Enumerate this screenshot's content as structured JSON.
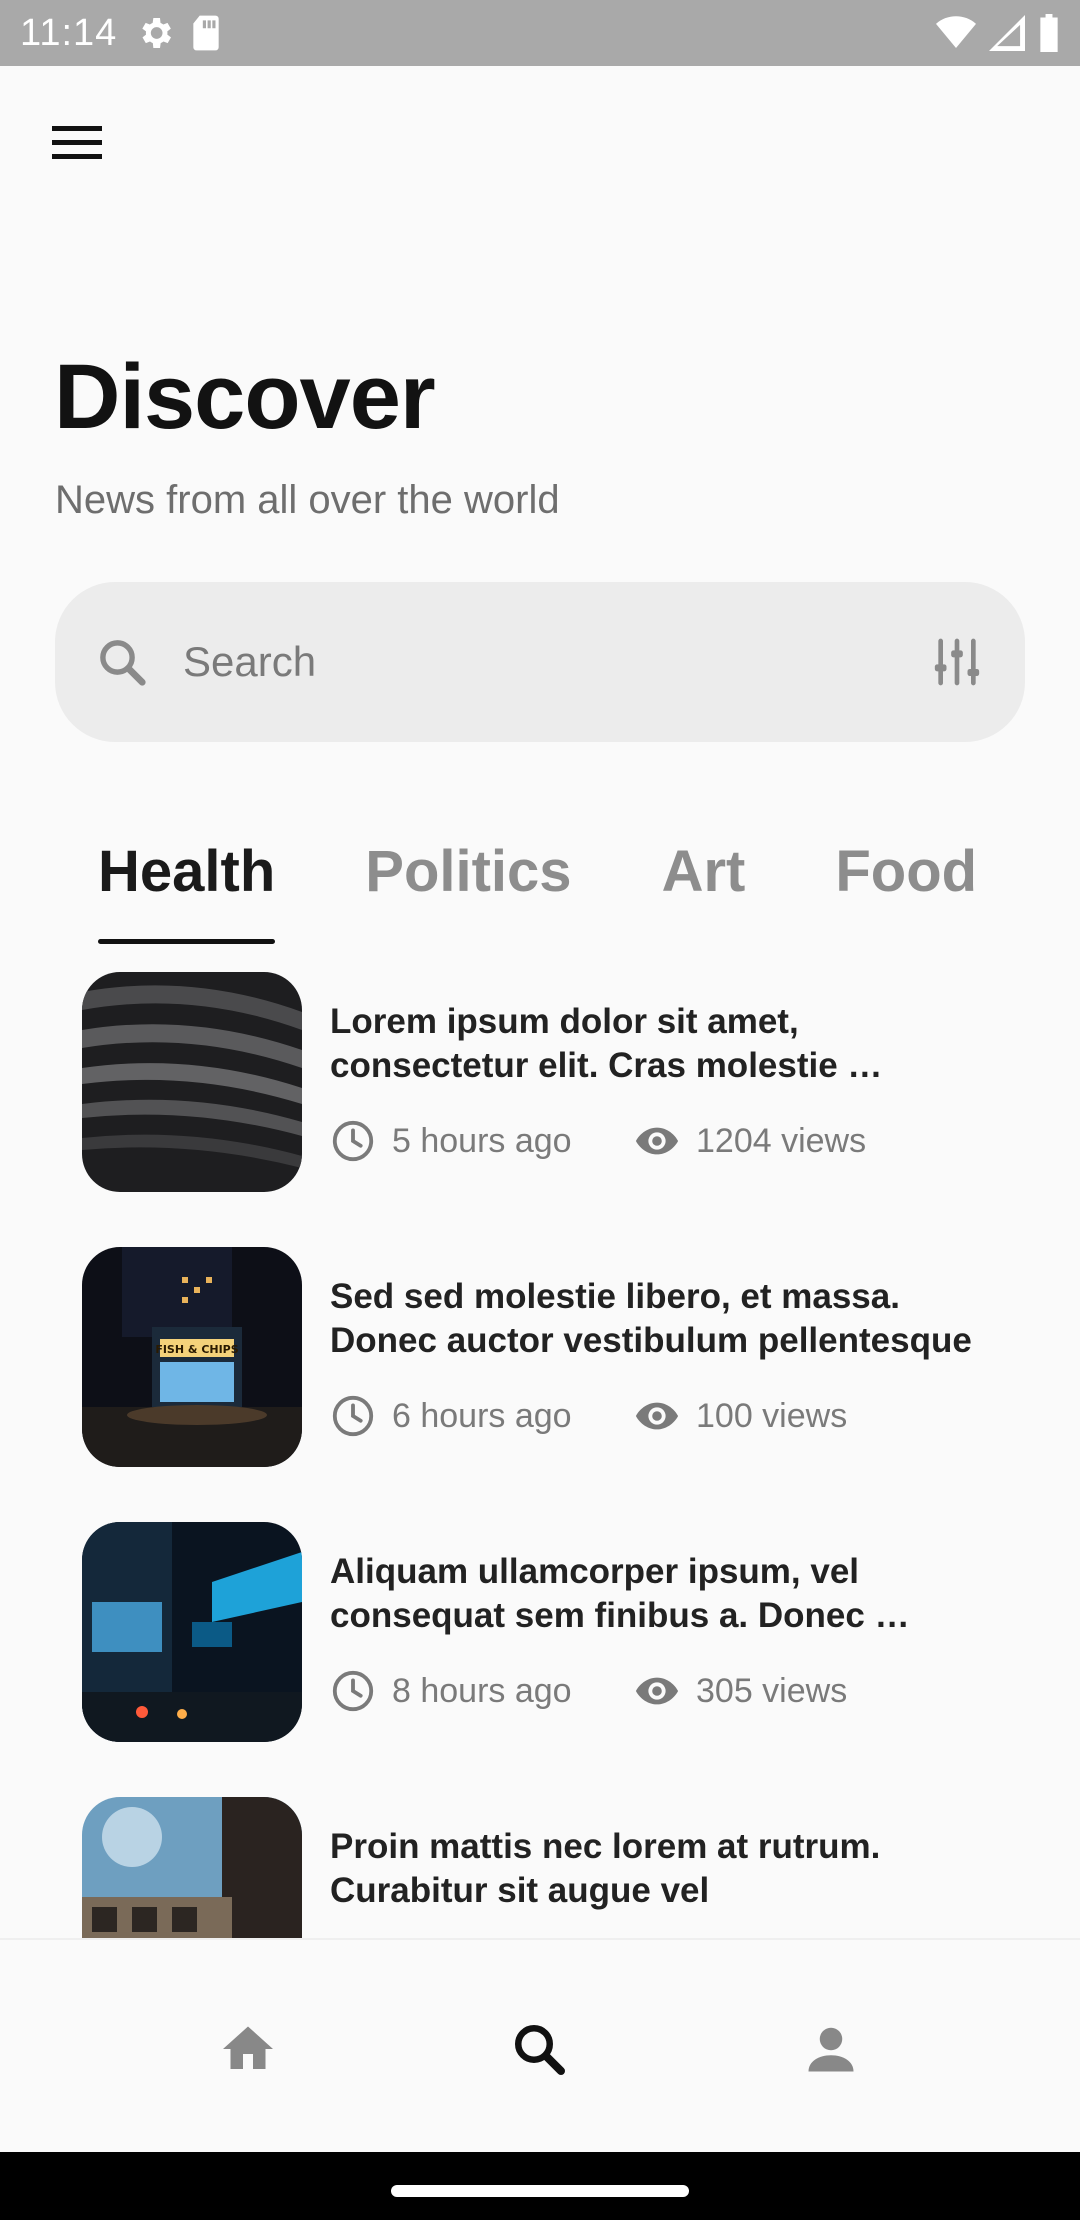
{
  "status_bar": {
    "time": "11:14"
  },
  "header": {
    "title": "Discover",
    "subtitle": "News from all over the world"
  },
  "search": {
    "placeholder": "Search",
    "value": ""
  },
  "tabs": [
    {
      "label": "Health",
      "active": true
    },
    {
      "label": "Politics",
      "active": false
    },
    {
      "label": "Art",
      "active": false
    },
    {
      "label": "Food",
      "active": false
    }
  ],
  "news": [
    {
      "title": "Lorem ipsum dolor sit amet, consectetur elit. Cras molestie …",
      "time": "5 hours ago",
      "views": "1204 views"
    },
    {
      "title": "Sed sed molestie libero, et massa. Donec auctor vestibulum pellentesque",
      "time": "6 hours ago",
      "views": "100 views",
      "thumb_sign": "FISH & CHIPS"
    },
    {
      "title": "Aliquam ullamcorper ipsum, vel consequat sem finibus a. Donec …",
      "time": "8 hours ago",
      "views": "305 views"
    },
    {
      "title": "Proin mattis nec lorem at rutrum. Curabitur sit augue vel"
    }
  ],
  "bottom_nav": [
    {
      "icon": "home-icon",
      "active": false
    },
    {
      "icon": "search-icon",
      "active": true
    },
    {
      "icon": "person-icon",
      "active": false
    }
  ],
  "colors": {
    "background": "#fafafa",
    "search_bg": "#ececec",
    "text_primary": "#1c1c1c",
    "text_secondary": "#7a7a7a",
    "status_bar": "#a9a9a9"
  }
}
